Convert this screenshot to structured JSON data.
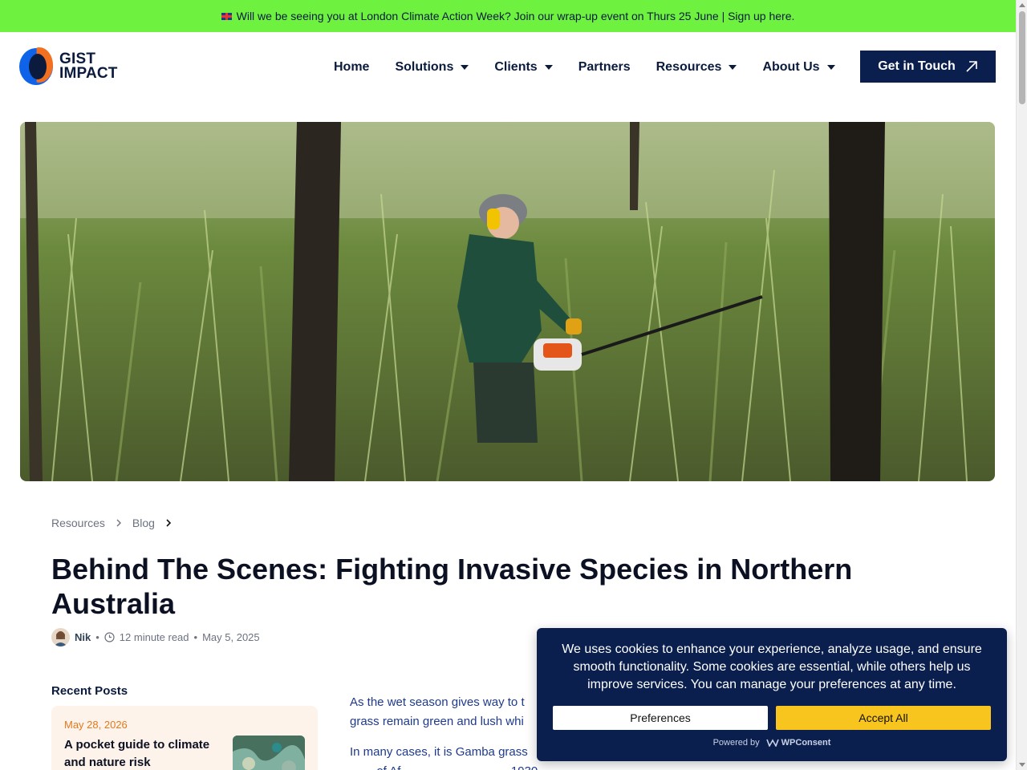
{
  "announcement": {
    "text": "Will we be seeing you at London Climate Action Week? Join our wrap-up event on Thurs 25 June | Sign up here."
  },
  "logo": {
    "line1": "GIST",
    "line2": "IMPACT"
  },
  "nav": {
    "items": [
      {
        "label": "Home",
        "dropdown": false
      },
      {
        "label": "Solutions",
        "dropdown": true
      },
      {
        "label": "Clients",
        "dropdown": true
      },
      {
        "label": "Partners",
        "dropdown": false
      },
      {
        "label": "Resources",
        "dropdown": true
      },
      {
        "label": "About Us",
        "dropdown": true
      }
    ],
    "cta": "Get in Touch"
  },
  "breadcrumb": {
    "items": [
      "Resources",
      "Blog"
    ]
  },
  "article": {
    "title": "Behind The Scenes: Fighting Invasive Species in Northern Australia",
    "author": "Nik",
    "read_time": "12 minute read",
    "date": "May 5, 2025",
    "para1_line1": "As the wet season gives way to t",
    "para1_line2": "grass remain green and lush whi",
    "para2_line1": "In many cases, it is Gamba grass",
    "para2_line2": "... ... of Af ... ... ... ... ... ... ... ... 1930 ... ... ..."
  },
  "sidebar": {
    "recent_title": "Recent Posts",
    "posts": [
      {
        "date": "May 28, 2026",
        "title": "A pocket guide to climate and nature risk"
      }
    ]
  },
  "cookie": {
    "message": "We uses cookies to enhance your experience, analyze usage, and ensure smooth functionality. Some cookies are essential, while others help us improve services. You can manage your preferences at any time.",
    "preferences_label": "Preferences",
    "accept_label": "Accept All",
    "powered_by": "Powered by",
    "brand": "WPConsent"
  },
  "colors": {
    "announcement_bg": "#6ef23f",
    "brand_navy": "#0a1f4e",
    "brand_orange": "#f37021",
    "brand_blue": "#0f63e8",
    "accept_yellow": "#f7c51d"
  }
}
